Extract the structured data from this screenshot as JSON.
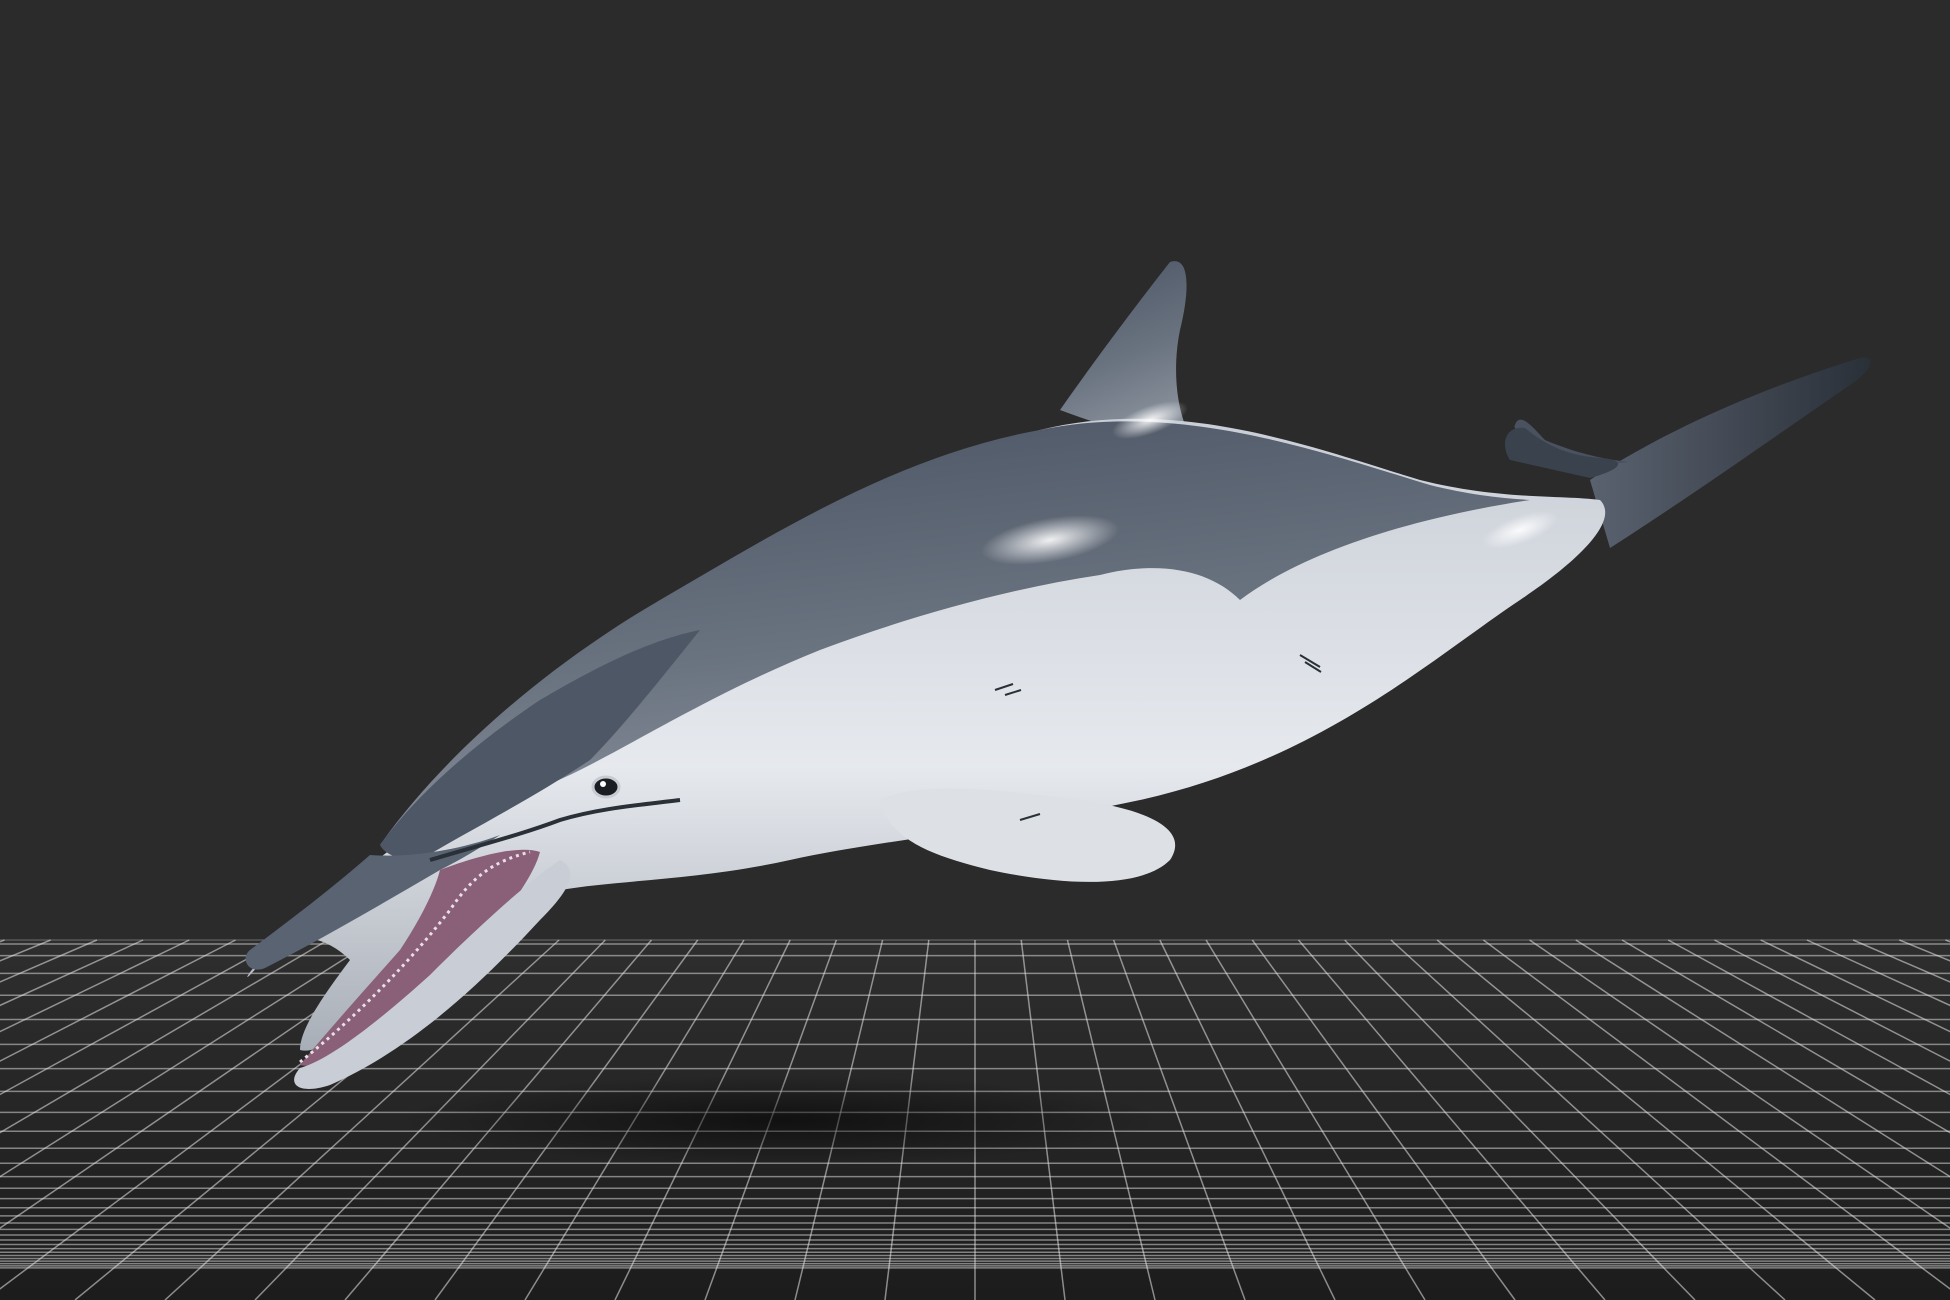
{
  "scene": {
    "subject": "dolphin-model",
    "background_color": "#2b2b2b",
    "floor_color": "#232323",
    "grid_line_color": "#e8e8e8",
    "dolphin_back_color": "#3d4654",
    "dolphin_belly_color": "#d4d8de",
    "mouth_color": "#8a5f78"
  }
}
